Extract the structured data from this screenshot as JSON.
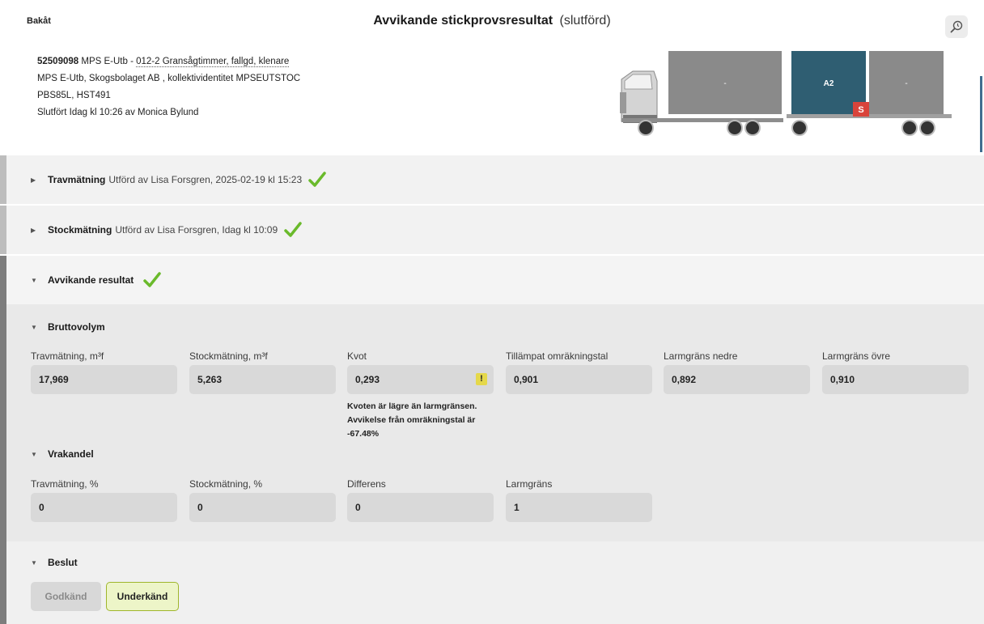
{
  "header": {
    "back_label": "Bakåt",
    "title": "Avvikande stickprovsresultat",
    "status": "(slutförd)",
    "search_icon": "search-history-icon"
  },
  "info": {
    "order_id": "52509098",
    "line1_mid": "MPS E-Utb - ",
    "line1_link": "012-2 Gransågtimmer, fallgd, klenare",
    "line2": "MPS E-Utb, Skogsbolaget AB , kollektividentitet MPSEUTSTOC",
    "line3": "PBS85L, HST491",
    "line4": "Slutfört Idag kl 10:26 av Monica Bylund"
  },
  "truck": {
    "load1": "-",
    "load2": "A2",
    "load3": "-",
    "marker": "S",
    "colors": {
      "load": "#8a8a8a",
      "selected": "#2f5e72",
      "marker": "#d9443b"
    }
  },
  "sections": {
    "travmatning": {
      "title": "Travmätning",
      "meta": "Utförd av Lisa Forsgren, 2025-02-19 kl 15:23"
    },
    "stockmatning": {
      "title": "Stockmätning",
      "meta": "Utförd av Lisa Forsgren, Idag kl 10:09"
    },
    "avvikande": {
      "title": "Avvikande resultat"
    }
  },
  "bruttovolym": {
    "title": "Bruttovolym",
    "fields": [
      {
        "label": "Travmätning, m³f",
        "value": "17,969"
      },
      {
        "label": "Stockmätning, m³f",
        "value": "5,263"
      },
      {
        "label": "Kvot",
        "value": "0,293"
      },
      {
        "label": "Tillämpat omräkningstal",
        "value": "0,901"
      },
      {
        "label": "Larmgräns nedre",
        "value": "0,892"
      },
      {
        "label": "Larmgräns övre",
        "value": "0,910"
      }
    ],
    "warning_icon": "!",
    "warning_line1": "Kvoten är lägre än larmgränsen.",
    "warning_line2": "Avvikelse från omräkningstal är",
    "warning_line3": "-67.48%"
  },
  "vrakandel": {
    "title": "Vrakandel",
    "fields": [
      {
        "label": "Travmätning, %",
        "value": "0"
      },
      {
        "label": "Stockmätning, %",
        "value": "0"
      },
      {
        "label": "Differens",
        "value": "0"
      },
      {
        "label": "Larmgräns",
        "value": "1"
      }
    ]
  },
  "beslut": {
    "title": "Beslut",
    "approve_label": "Godkänd",
    "reject_label": "Underkänd"
  },
  "colors": {
    "check": "#6aba2b",
    "accent": "#3f6e90",
    "warning": "#e5d84a",
    "selected_button": "#edf5c8"
  }
}
